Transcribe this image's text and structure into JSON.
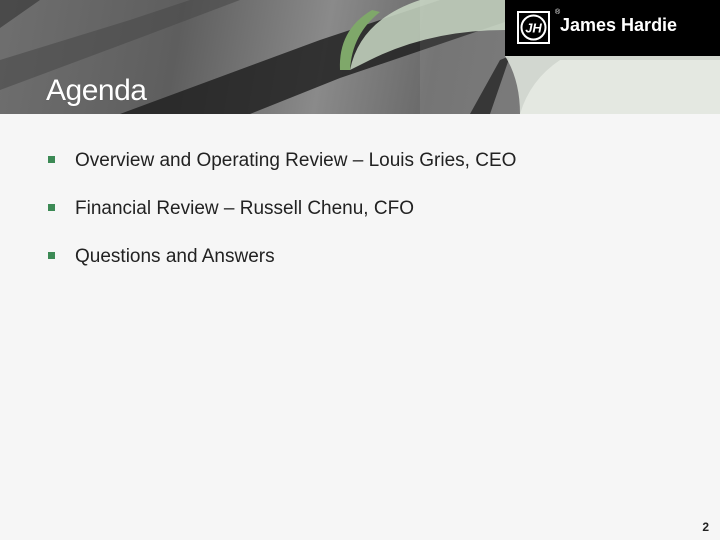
{
  "slide": {
    "title": "Agenda",
    "logo": {
      "brand_text": "James Hardie",
      "mark_text": "JH",
      "registered": "®"
    },
    "bullets": [
      {
        "text": "Overview and Operating Review – Louis Gries, CEO"
      },
      {
        "text": "Financial Review – Russell Chenu, CFO"
      },
      {
        "text": "Questions and Answers"
      }
    ],
    "page_number": "2"
  },
  "colors": {
    "background": "#f6f6f6",
    "bullet_marker": "#3c8a55",
    "logo_background": "#000000",
    "title_text": "#ffffff"
  }
}
